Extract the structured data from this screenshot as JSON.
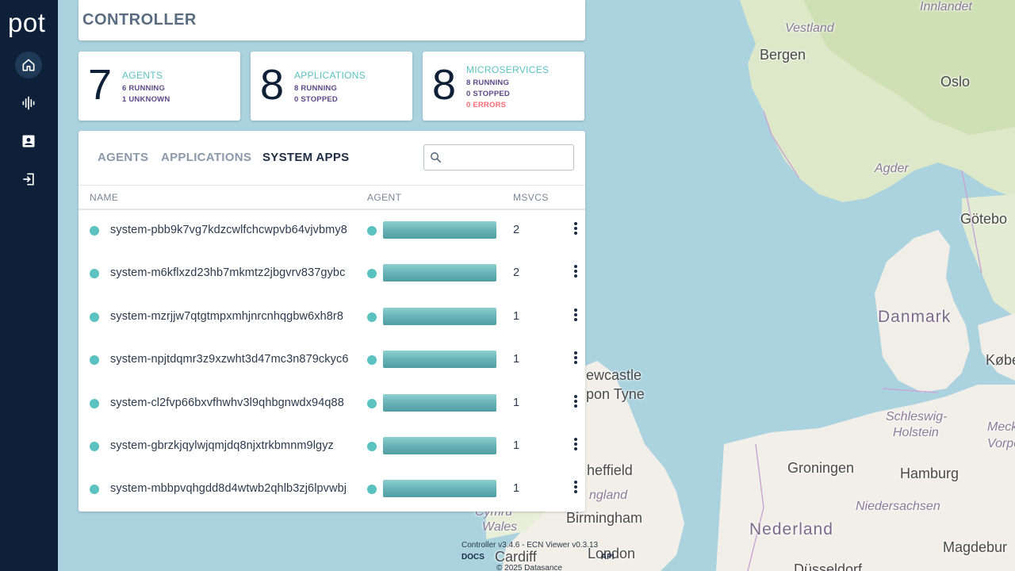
{
  "app": {
    "logo": "pot"
  },
  "sidebar": {
    "items": [
      {
        "name": "home",
        "icon": "home-icon",
        "active": true
      },
      {
        "name": "activity",
        "icon": "activity-icon",
        "active": false
      },
      {
        "name": "catalog",
        "icon": "account-box-icon",
        "active": false
      },
      {
        "name": "logout",
        "icon": "logout-icon",
        "active": false
      }
    ]
  },
  "header": {
    "title": "CONTROLLER"
  },
  "stats": {
    "agents": {
      "count": "7",
      "title": "AGENTS",
      "lines": [
        "6 RUNNING",
        "1 UNKNOWN"
      ]
    },
    "applications": {
      "count": "8",
      "title": "APPLICATIONS",
      "lines": [
        "8 RUNNING",
        "0 STOPPED"
      ]
    },
    "microservices": {
      "count": "8",
      "title": "MICROSERVICES",
      "lines": [
        "8 RUNNING",
        "0 STOPPED"
      ],
      "error_line": "0 ERRORS"
    }
  },
  "tabs": [
    {
      "label": "AGENTS",
      "active": false
    },
    {
      "label": "APPLICATIONS",
      "active": false
    },
    {
      "label": "SYSTEM APPS",
      "active": true
    }
  ],
  "search": {
    "placeholder": "",
    "value": ""
  },
  "table": {
    "columns": {
      "name": "NAME",
      "agent": "AGENT",
      "msvcs": "MSVCS"
    },
    "rows": [
      {
        "name": "system-pbb9k7vg7kdzcwlfchcwpvb64vjvbmy8",
        "msvcs": "2"
      },
      {
        "name": "system-m6kflxzd23hb7mkmtz2jbgvrv837gybc",
        "msvcs": "2"
      },
      {
        "name": "system-mzrjjw7qtgtmpxmhjnrcnhqgbw6xh8r8",
        "msvcs": "1"
      },
      {
        "name": "system-npjtdqmr3z9xzwht3d47mc3n879ckyc6",
        "msvcs": "1"
      },
      {
        "name": "system-cl2fvp66bxvfhwhv3l9qhbgnwdx94q88",
        "msvcs": "1"
      },
      {
        "name": "system-gbrzkjqylwjqmjdq8njxtrkbmnm9lgyz",
        "msvcs": "1"
      },
      {
        "name": "system-mbbpvqhgdd8d4wtwb2qhlb3zj6lpvwbj",
        "msvcs": "1"
      }
    ]
  },
  "footer": {
    "version": "Controller v3.4.6 - ECN Viewer v0.3.13",
    "links": [
      "DOCS",
      "API"
    ],
    "copyright": "© 2025 Datasance"
  },
  "map": {
    "labels": [
      {
        "text": "Innlandet",
        "kind": "region"
      },
      {
        "text": "Vestland",
        "kind": "region"
      },
      {
        "text": "Bergen",
        "kind": "city"
      },
      {
        "text": "Oslo",
        "kind": "city"
      },
      {
        "text": "Agder",
        "kind": "region"
      },
      {
        "text": "Götebo",
        "kind": "city"
      },
      {
        "text": "Danmark",
        "kind": "country"
      },
      {
        "text": "Køben",
        "kind": "city"
      },
      {
        "text": "ewcastle",
        "kind": "city"
      },
      {
        "text": "pon Tyne",
        "kind": "city"
      },
      {
        "text": "Schleswig-",
        "kind": "region"
      },
      {
        "text": "Holstein",
        "kind": "region"
      },
      {
        "text": "Meckle",
        "kind": "region"
      },
      {
        "text": "Vorpor",
        "kind": "region"
      },
      {
        "text": "heffield",
        "kind": "city"
      },
      {
        "text": "Groningen",
        "kind": "city"
      },
      {
        "text": "Hamburg",
        "kind": "city"
      },
      {
        "text": "ngland",
        "kind": "region"
      },
      {
        "text": "Niedersachsen",
        "kind": "region"
      },
      {
        "text": "Cymru",
        "kind": "region"
      },
      {
        "text": "Wales",
        "kind": "region"
      },
      {
        "text": "Birmingham",
        "kind": "city"
      },
      {
        "text": "Nederland",
        "kind": "country"
      },
      {
        "text": "Cardiff",
        "kind": "city"
      },
      {
        "text": "London",
        "kind": "city"
      },
      {
        "text": "Düsseldorf",
        "kind": "city"
      },
      {
        "text": "Magdebur",
        "kind": "city"
      }
    ]
  }
}
